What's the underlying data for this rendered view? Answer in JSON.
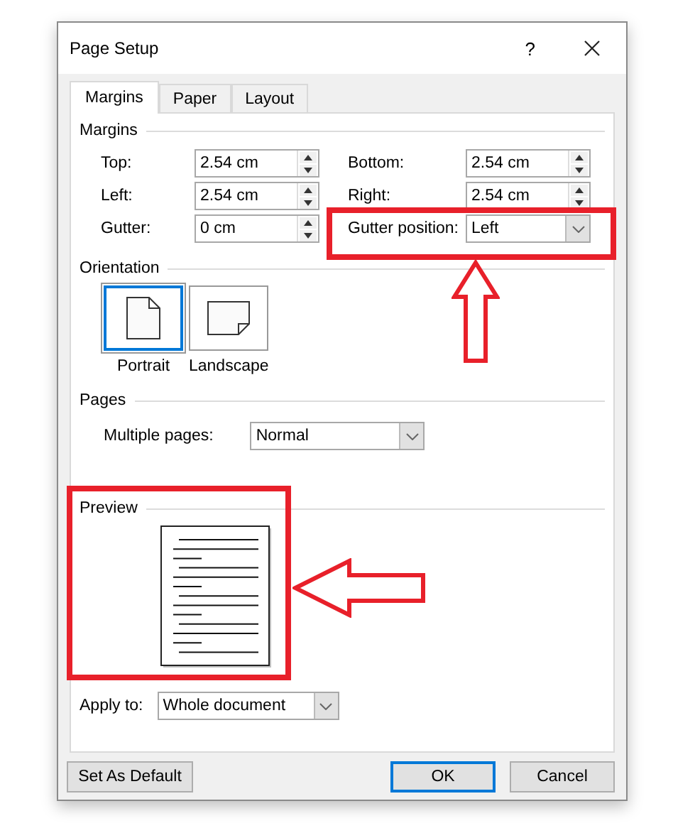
{
  "window": {
    "title": "Page Setup",
    "help": "?"
  },
  "tabs": [
    {
      "label": "Margins",
      "selected": true
    },
    {
      "label": "Paper",
      "selected": false
    },
    {
      "label": "Layout",
      "selected": false
    }
  ],
  "margins": {
    "title": "Margins",
    "fields": [
      {
        "label": "Top:",
        "value": "2.54 cm",
        "kind": "spin"
      },
      {
        "label": "Bottom:",
        "value": "2.54 cm",
        "kind": "spin"
      },
      {
        "label": "Left:",
        "value": "2.54 cm",
        "kind": "spin"
      },
      {
        "label": "Right:",
        "value": "2.54 cm",
        "kind": "spin"
      },
      {
        "label": "Gutter:",
        "value": "0 cm",
        "kind": "spin"
      },
      {
        "label": "Gutter position:",
        "value": "Left",
        "kind": "dropdown"
      }
    ]
  },
  "orientation": {
    "title": "Orientation",
    "options": [
      {
        "label": "Portrait",
        "kind": "portrait",
        "selected": true
      },
      {
        "label": "Landscape",
        "kind": "landscape",
        "selected": false
      }
    ]
  },
  "pages": {
    "title": "Pages",
    "multiple_pages": {
      "label": "Multiple pages:",
      "value": "Normal"
    }
  },
  "preview": {
    "title": "Preview"
  },
  "apply_to": {
    "label": "Apply to:",
    "value": "Whole document"
  },
  "buttons": [
    {
      "label": "Set As Default",
      "default": false
    },
    {
      "label": "OK",
      "default": true
    },
    {
      "label": "Cancel",
      "default": false
    }
  ]
}
